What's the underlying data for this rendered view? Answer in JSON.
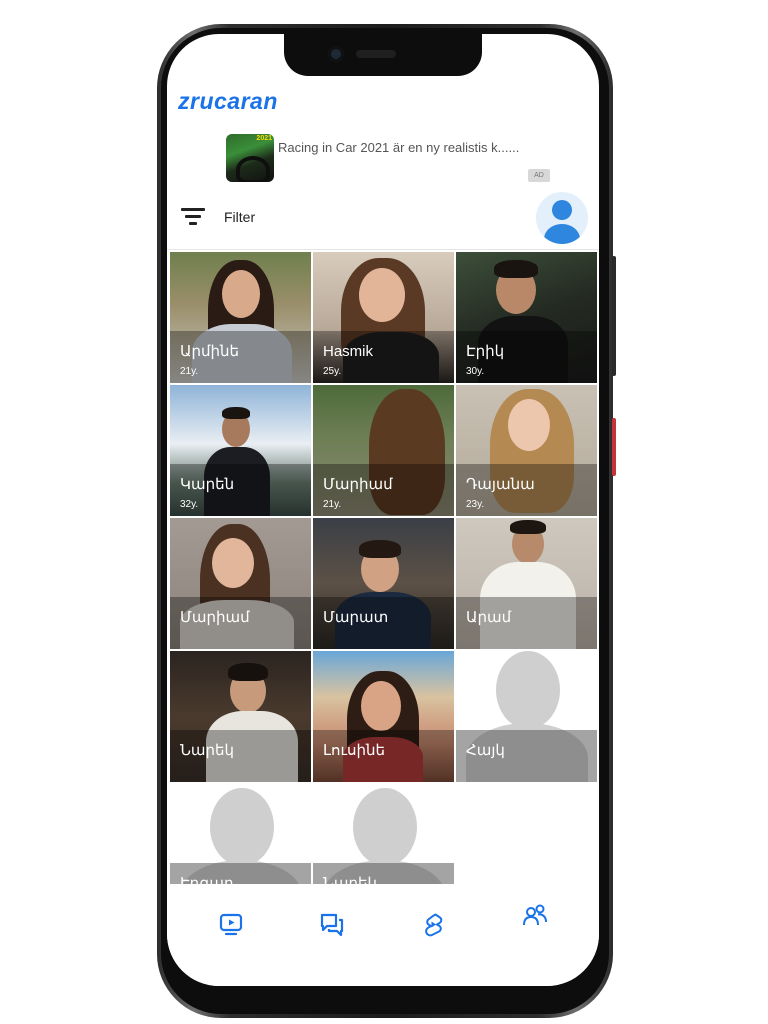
{
  "app": {
    "logo_text": "zrucaran",
    "brand_color": "#1a73e8"
  },
  "ad": {
    "text": "Racing in Car 2021 är en ny realistis k......",
    "thumbnail_label": "2021",
    "badge": "AD"
  },
  "toolbar": {
    "filter_icon": "filter-icon",
    "filter_label": "Filter",
    "profile_icon": "user-avatar-icon"
  },
  "profiles": [
    {
      "name": "Արմինե",
      "age": "21y."
    },
    {
      "name": "Hasmik",
      "age": "25y."
    },
    {
      "name": "Էրիկ",
      "age": "30y."
    },
    {
      "name": "Կարեն",
      "age": "32y."
    },
    {
      "name": "Մարիամ",
      "age": "21y."
    },
    {
      "name": "Դայանա",
      "age": "23y."
    },
    {
      "name": "Մարիամ",
      "age": ""
    },
    {
      "name": "Մարատ",
      "age": ""
    },
    {
      "name": "Արամ",
      "age": ""
    },
    {
      "name": "Նարեկ",
      "age": ""
    },
    {
      "name": "Լուսինե",
      "age": ""
    },
    {
      "name": "Հայկ",
      "age": ""
    },
    {
      "name": "Էդգար",
      "age": ""
    },
    {
      "name": "Նարեկ",
      "age": ""
    }
  ],
  "bottom_nav": {
    "items": [
      {
        "icon": "video-icon"
      },
      {
        "icon": "chat-icon"
      },
      {
        "icon": "shorts-icon"
      },
      {
        "icon": "people-icon"
      }
    ],
    "active_color": "#1a73e8"
  }
}
